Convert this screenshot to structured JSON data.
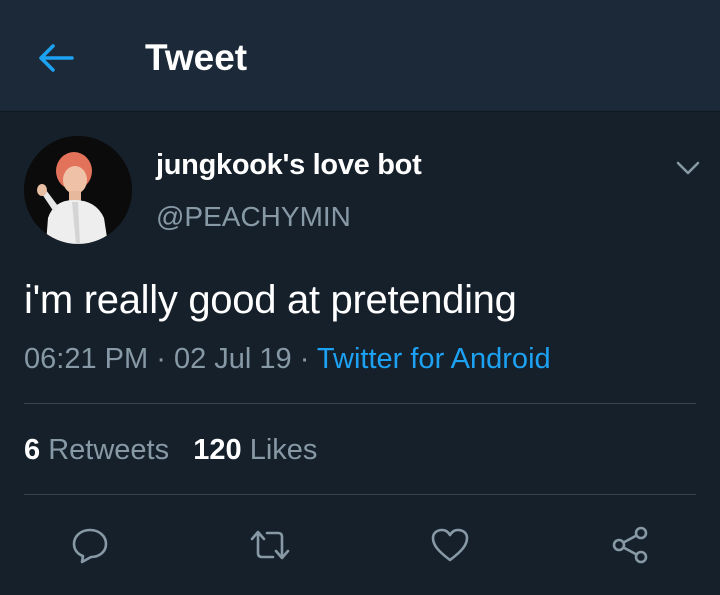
{
  "header": {
    "back_icon": "arrow-left-icon",
    "title": "Tweet"
  },
  "tweet": {
    "author": {
      "display_name": "jungkook's love bot",
      "handle": "@PEACHYMIN",
      "avatar": "profile-photo"
    },
    "text": "i'm really good at pretending",
    "time": "06:21 PM",
    "separator": "·",
    "date": "02 Jul 19",
    "source": "Twitter for Android",
    "stats": {
      "retweets_count": "6",
      "retweets_label": "Retweets",
      "likes_count": "120",
      "likes_label": "Likes"
    },
    "actions": [
      "reply-icon",
      "retweet-icon",
      "like-icon",
      "share-icon"
    ]
  },
  "colors": {
    "background": "#15202b",
    "header_background": "#1c2938",
    "accent": "#1da1f2",
    "secondary_text": "#8899a6",
    "divider": "#38444d"
  }
}
